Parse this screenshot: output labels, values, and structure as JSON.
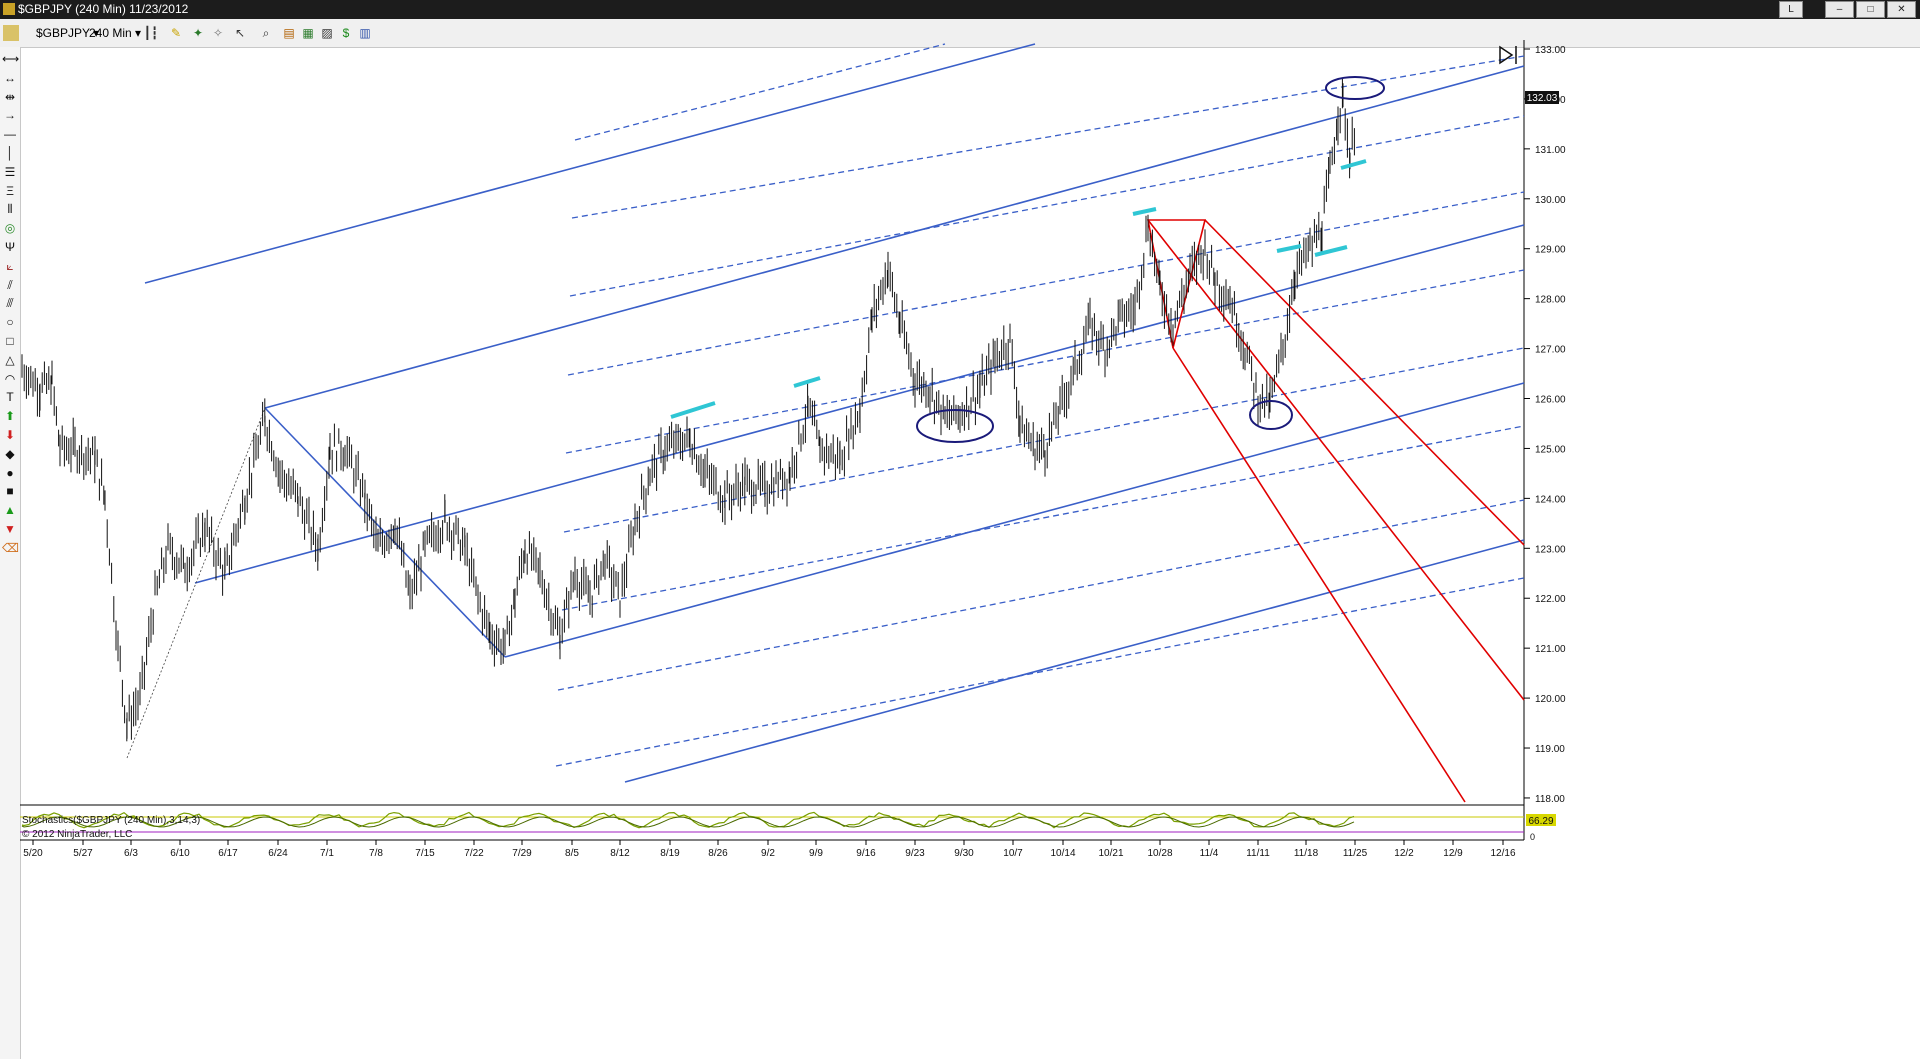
{
  "window": {
    "title": "$GBPJPY (240 Min)  11/23/2012",
    "btn_l": "L",
    "btn_min": "–",
    "btn_max": "□",
    "btn_close": "✕"
  },
  "toolbar": {
    "instrument": "$GBPJPY",
    "interval": "240 Min",
    "icons": [
      "bar-type-icon",
      "pencil-icon",
      "add-indicator-icon",
      "strategy-icon",
      "cursor-icon",
      "zoom-icon",
      "template-icon",
      "properties-icon",
      "data-box-icon",
      "money-icon",
      "panel-icon"
    ]
  },
  "left_tools": [
    "line-icon",
    "ray-icon",
    "extended-line-icon",
    "arrow-line-icon",
    "horizontal-line-icon",
    "vertical-line-icon",
    "fib-retracement-icon",
    "fib-extension-icon",
    "fib-timezones-icon",
    "fib-circle-icon",
    "andrews-pitchfork-icon",
    "gann-fan-icon",
    "regression-channel-icon",
    "trend-channel-icon",
    "ellipse-icon",
    "rectangle-icon",
    "triangle-icon",
    "arc-icon",
    "text-icon",
    "arrow-up-icon",
    "arrow-down-icon",
    "diamond-icon",
    "dot-icon",
    "square-icon",
    "triangle-up-icon",
    "triangle-down-icon",
    "eraser-icon"
  ],
  "chart": {
    "price_marker": "132.03",
    "y_ticks": [
      "133.00",
      "132.00",
      "131.00",
      "130.00",
      "129.00",
      "128.00",
      "127.00",
      "126.00",
      "125.00",
      "124.00",
      "123.00",
      "122.00",
      "121.00",
      "120.00",
      "119.00",
      "118.00"
    ],
    "x_ticks": [
      "5/20",
      "5/27",
      "6/3",
      "6/10",
      "6/17",
      "6/24",
      "7/1",
      "7/8",
      "7/15",
      "7/22",
      "7/29",
      "8/5",
      "8/12",
      "8/19",
      "8/26",
      "9/2",
      "9/9",
      "9/16",
      "9/23",
      "9/30",
      "10/7",
      "10/14",
      "10/21",
      "10/28",
      "11/4",
      "11/11",
      "11/18",
      "11/25",
      "12/2",
      "12/9",
      "12/16"
    ],
    "stoch_label": "Stochastics($GBPJPY (240 Min),3,14,3)",
    "stoch_value": "66.29",
    "stoch_zero": "0",
    "copyright": "© 2012 NinjaTrader, LLC",
    "price_color": "#111111",
    "pitchfork_color": "#3a5fc8",
    "red_fork_color": "#e00000",
    "highlight_color": "#2fc6d4",
    "ellipse_color": "#1a1a7a"
  }
}
